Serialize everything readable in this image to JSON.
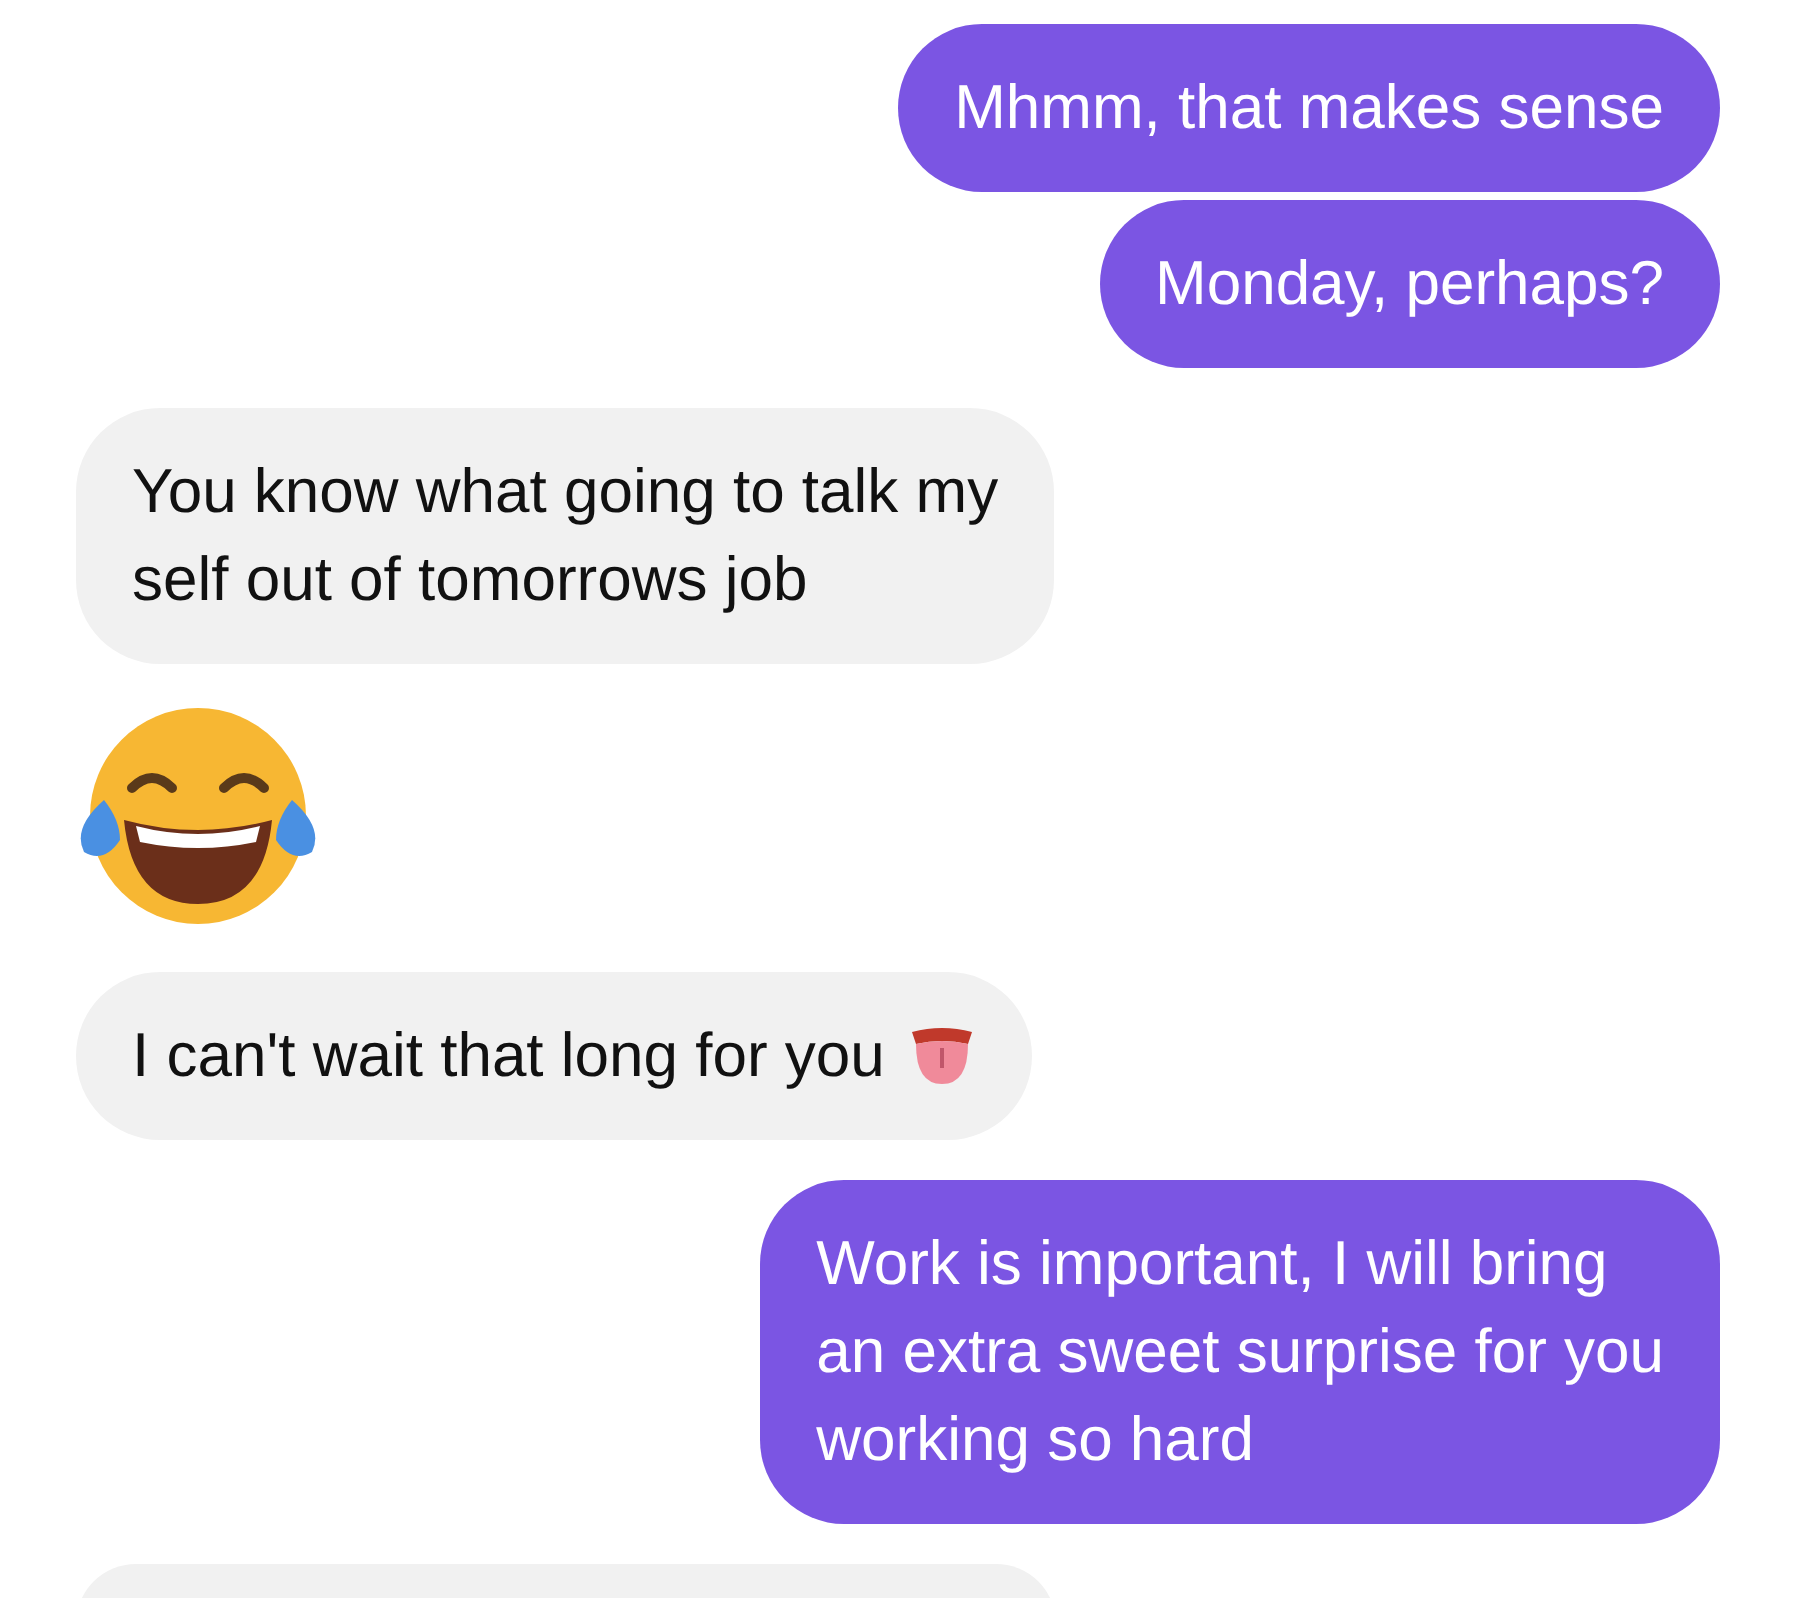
{
  "messages": [
    {
      "kind": "sent",
      "lines": [
        "Mhmm, that makes sense"
      ]
    },
    {
      "kind": "sent",
      "lines": [
        "Monday, perhaps?"
      ]
    },
    {
      "kind": "received",
      "lines": [
        "You know what going to talk my",
        "self out of tomorrows job"
      ]
    },
    {
      "kind": "emoji"
    },
    {
      "kind": "received",
      "lines": [
        "I can't wait that long for you"
      ],
      "tongue_emoji": true
    },
    {
      "kind": "sent",
      "lines": [
        "Work is important, I will bring",
        "an extra sweet surprise for you",
        "working so hard"
      ]
    },
    {
      "kind": "clipped"
    }
  ]
}
